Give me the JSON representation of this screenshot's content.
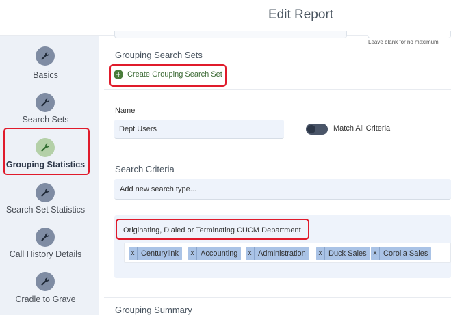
{
  "header": {
    "title": "Edit Report"
  },
  "sidebar": {
    "items": [
      {
        "label": "Basics",
        "icon": "wrench-icon",
        "active": false
      },
      {
        "label": "Search Sets",
        "icon": "wrench-icon",
        "active": false
      },
      {
        "label": "Grouping Statistics",
        "icon": "wrench-icon",
        "active": true
      },
      {
        "label": "Search Set Statistics",
        "icon": "wrench-icon",
        "active": false
      },
      {
        "label": "Call History Details",
        "icon": "wrench-icon",
        "active": false
      },
      {
        "label": "Cradle to Grave",
        "icon": "wrench-icon",
        "active": false
      }
    ]
  },
  "main": {
    "hint": "Leave blank for no maximum",
    "grouping_section_title": "Grouping Search Sets",
    "create_button_label": "Create Grouping Search Set",
    "name_label": "Name",
    "name_value": "Dept Users",
    "match_all_label": "Match All Criteria",
    "search_criteria_title": "Search Criteria",
    "search_placeholder": "Add new search type...",
    "criteria_label": "Originating, Dialed or Terminating CUCM Department",
    "tags": [
      "Centurylink",
      "Accounting",
      "Administration",
      "Duck Sales",
      "Corolla Sales"
    ],
    "tag_remove_symbol": "x",
    "grouping_summary_title": "Grouping Summary"
  },
  "colors": {
    "highlight": "#e01b2b",
    "active_icon": "#b4d0a8",
    "icon": "#7f8ca3",
    "tag": "#aac3e6",
    "create_green": "#4a7d3b"
  }
}
